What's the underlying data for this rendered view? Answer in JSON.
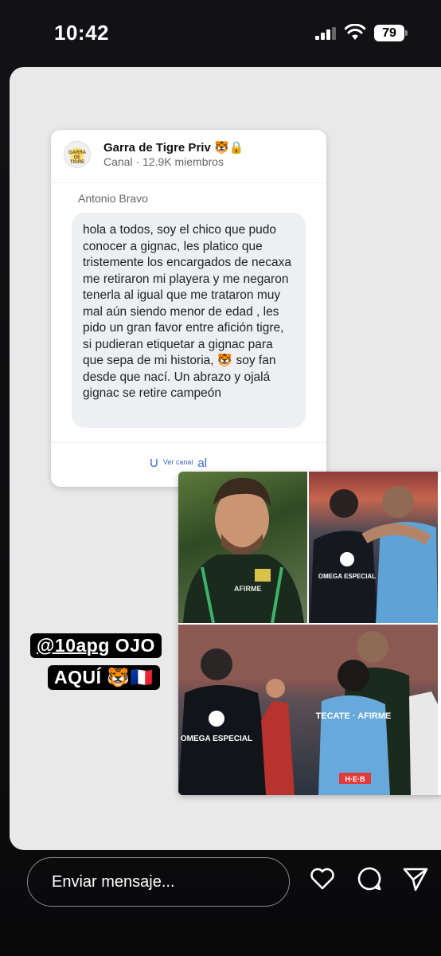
{
  "status": {
    "time": "10:42",
    "battery": "79"
  },
  "post": {
    "channel_name": "Garra de Tigre Priv 🐯🔒",
    "channel_meta": "Canal · 12.9K miembros",
    "avatar_text": "GARRA DE TIGRE",
    "sender": "Antonio Bravo",
    "message": "hola a todos, soy el chico que pudo conocer a gignac, les platico que tristemente los encargados de necaxa me retiraron mi playera y me negaron tenerla al igual que me trataron muy mal aún siendo menor de edad , les pido un gran favor entre afición tigre, si pudieran etiquetar a gignac para que sepa de mi historia, 🐯 soy fan desde que nací. Un abrazo y ojalá gignac se retire campeón",
    "footer_left": "U",
    "footer_small": "Ver canal",
    "footer_right": "al"
  },
  "mention": {
    "handle": "@10apg",
    "line1_rest": "OJO",
    "line2": "AQUÍ 🐯🇫🇷"
  },
  "bottom_bar": {
    "placeholder": "Enviar mensaje..."
  },
  "photos": {
    "tl_crest": "AFIRME",
    "tr_logo": "OMEGA ESPECIAL",
    "b_logo": "OMEGA ESPECIAL",
    "b_jersey": "TECATE · AFIRME",
    "b_sponsor": "H·E·B"
  }
}
